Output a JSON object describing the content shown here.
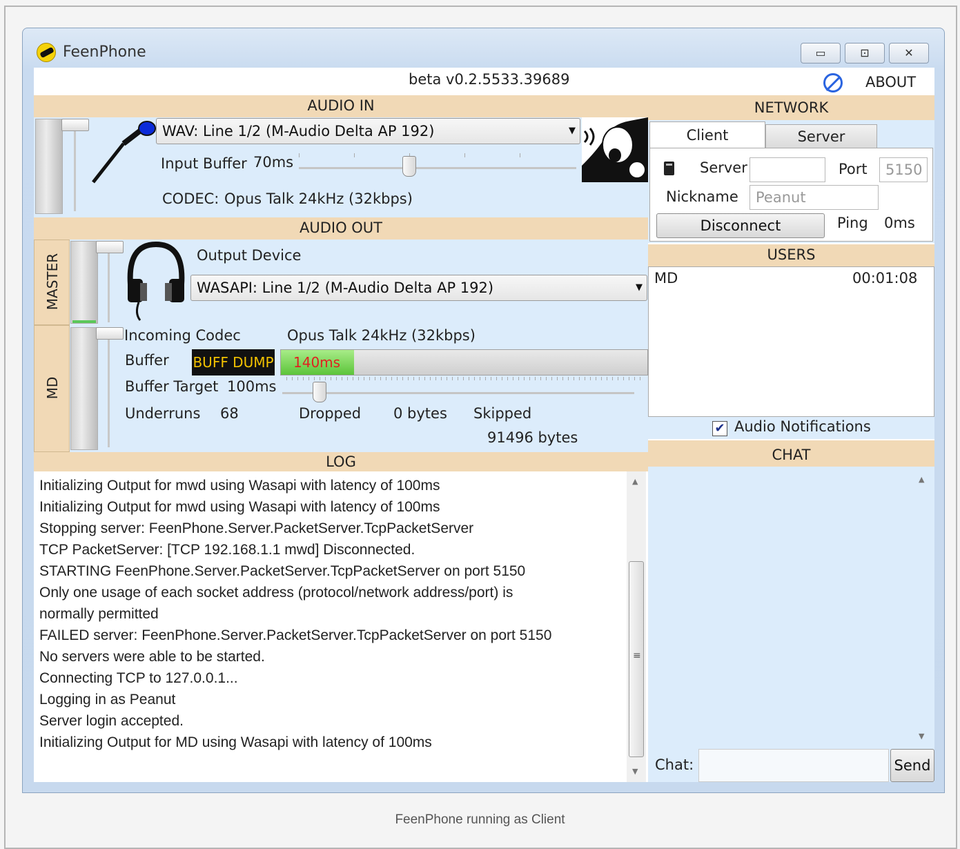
{
  "window": {
    "title": "FeenPhone",
    "version": "beta v0.2.5533.39689",
    "about_label": "ABOUT",
    "minimize_glyph": "▭",
    "maximize_glyph": "⊡",
    "close_glyph": "✕"
  },
  "audio_in": {
    "header": "AUDIO IN",
    "device": "WAV: Line 1/2 (M-Audio Delta AP 192)",
    "input_buffer_label": "Input Buffer",
    "input_buffer_value": "70ms",
    "codec_label": "CODEC:",
    "codec_value": "Opus Talk 24kHz (32kbps)"
  },
  "audio_out": {
    "header": "AUDIO OUT",
    "master_label": "MASTER",
    "user_label": "MD",
    "output_device_label": "Output Device",
    "output_device": "WASAPI: Line 1/2 (M-Audio Delta AP 192)",
    "incoming_codec_label": "Incoming Codec",
    "incoming_codec_value": "Opus Talk 24kHz (32kbps)",
    "buffer_label": "Buffer",
    "buff_dump_label": "BUFF DUMP",
    "buffer_value": "140ms",
    "buffer_target_label": "Buffer Target",
    "buffer_target_value": "100ms",
    "underruns_label": "Underruns",
    "underruns_value": "68",
    "dropped_label": "Dropped",
    "dropped_value": "0 bytes",
    "skipped_label": "Skipped",
    "skipped_value": "91496 bytes"
  },
  "network": {
    "header": "NETWORK",
    "tabs": [
      {
        "label": "Client"
      },
      {
        "label": "Server"
      }
    ],
    "server_label": "Server",
    "server_value": "",
    "port_label": "Port",
    "port_value": "5150",
    "nickname_label": "Nickname",
    "nickname_value": "Peanut",
    "disconnect_label": "Disconnect",
    "ping_label": "Ping",
    "ping_value": "0ms"
  },
  "users": {
    "header": "USERS",
    "list": [
      {
        "name": "MD",
        "time": "00:01:08"
      }
    ],
    "audio_notifications_label": "Audio Notifications",
    "audio_notifications_checked": true
  },
  "log": {
    "header": "LOG",
    "lines": [
      "Initializing Output for mwd using Wasapi with latency of 100ms",
      "Initializing Output for mwd using Wasapi with latency of 100ms",
      "Stopping server: FeenPhone.Server.PacketServer.TcpPacketServer",
      "TCP PacketServer: [TCP 192.168.1.1 mwd] Disconnected.",
      "STARTING FeenPhone.Server.PacketServer.TcpPacketServer on port 5150",
      "Only one usage of each socket address (protocol/network address/port) is",
      "normally permitted",
      "FAILED server: FeenPhone.Server.PacketServer.TcpPacketServer on port 5150",
      "No servers were able to be started.",
      "Connecting TCP to 127.0.0.1...",
      "Logging in as Peanut",
      "Server login accepted.",
      "Initializing Output for MD using Wasapi with latency of 100ms"
    ]
  },
  "chat": {
    "header": "CHAT",
    "chat_label": "Chat:",
    "input_value": "",
    "send_label": "Send"
  },
  "caption": "FeenPhone running as Client",
  "colors": {
    "header_bg": "#f1d9b6",
    "panel_bg": "#dcecfb",
    "buff_dump_bg": "#111111",
    "buff_dump_fg": "#f2c200",
    "buffer_text": "#e02020",
    "buffer_fill": "#7ed65c"
  },
  "icons": {
    "logo": "feenphone-logo-icon",
    "about": "about-icon",
    "microphone": "microphone-icon",
    "headphones": "headphones-icon",
    "shout": "shouting-face-icon",
    "server": "server-icon"
  }
}
